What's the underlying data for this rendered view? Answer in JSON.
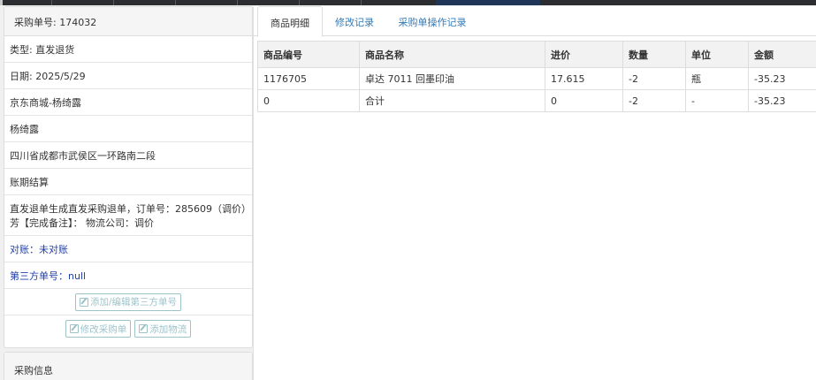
{
  "purchase_order": {
    "header": "采购单号: 174032",
    "type": "类型: 直发退货",
    "date": "日期: 2025/5/29",
    "store": "京东商城-杨绮露",
    "customer": "杨绮露",
    "address": "四川省成都市武侯区一环路南二段",
    "payment": "账期结算",
    "note": "直发退单生成直发采购退单，订单号：285609（调价）芳【完成备注】：  物流公司：调价",
    "reconcile": "对账：未对账",
    "third_party": "第三方单号：null"
  },
  "buttons": {
    "add_edit_third_party": "添加/编辑第三方单号",
    "modify_order": "修改采购单",
    "add_logistics": "添加物流"
  },
  "purchase_info": {
    "title": "采购信息"
  },
  "tabs": {
    "product_details": "商品明细",
    "modification_log": "修改记录",
    "operation_log": "采购单操作记录"
  },
  "table": {
    "headers": [
      "商品编号",
      "商品名称",
      "进价",
      "数量",
      "单位",
      "金额"
    ],
    "rows": [
      [
        "1176705",
        "卓达 7011 回墨印油",
        "17.615",
        "-2",
        "瓶",
        "-35.23"
      ],
      [
        "0",
        "合计",
        "0",
        "-2",
        "-",
        "-35.23"
      ]
    ]
  }
}
